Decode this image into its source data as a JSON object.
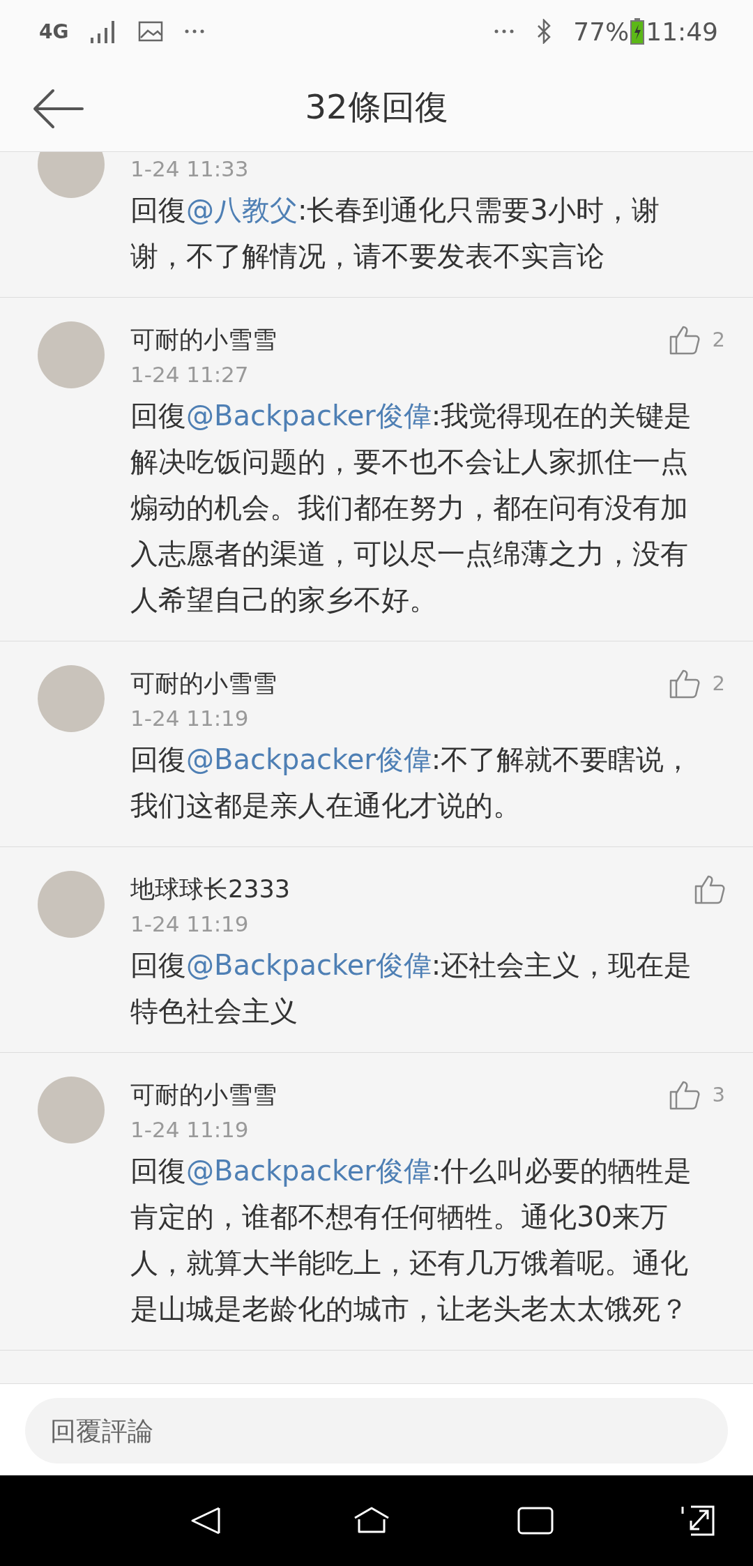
{
  "status_bar": {
    "network": "4G",
    "time": "11:49",
    "battery": "77%"
  },
  "header": {
    "title": "32條回復"
  },
  "comments": [
    {
      "time": "1-24 11:33",
      "prefix": "回復",
      "mention": "@八教父",
      "text": ":长春到通化只需要3小时，谢谢，不了解情况，请不要发表不实言论"
    },
    {
      "name": "可耐的小雪雪",
      "likes": "2",
      "time": "1-24 11:27",
      "prefix": "回復",
      "mention": "@Backpacker俊偉",
      "text": ":我觉得现在的关键是解决吃饭问题的，要不也不会让人家抓住一点煽动的机会。我们都在努力，都在问有没有加入志愿者的渠道，可以尽一点绵薄之力，没有人希望自己的家乡不好。"
    },
    {
      "name": "可耐的小雪雪",
      "likes": "2",
      "time": "1-24 11:19",
      "prefix": "回復",
      "mention": "@Backpacker俊偉",
      "text": ":不了解就不要瞎说，我们这都是亲人在通化才说的。"
    },
    {
      "name": "地球球长2333",
      "time": "1-24 11:19",
      "prefix": "回復",
      "mention": "@Backpacker俊偉",
      "text": ":还社会主义，现在是特色社会主义"
    },
    {
      "name": "可耐的小雪雪",
      "likes": "3",
      "time": "1-24 11:19",
      "prefix": "回復",
      "mention": "@Backpacker俊偉",
      "text": ":什么叫必要的牺牲是肯定的，谁都不想有任何牺牲。通化30来万人，就算大半能吃上，还有几万饿着呢。通化是山城是老龄化的城市，让老头老太太饿死？"
    }
  ],
  "reply_bar": {
    "placeholder": "回覆評論"
  }
}
